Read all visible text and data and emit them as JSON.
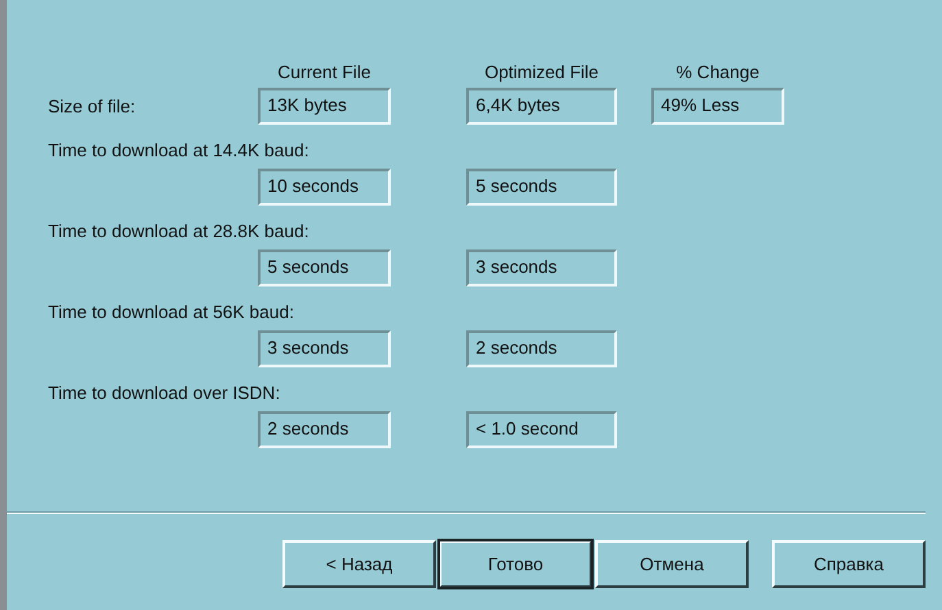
{
  "columns": [
    "Current File",
    "Optimized File",
    "% Change"
  ],
  "rows": [
    {
      "kind": "inline",
      "label": "Size of file:",
      "values": [
        "13K bytes",
        "6,4K bytes",
        "49% Less"
      ]
    },
    {
      "kind": "stacked",
      "label": "Time to download at 14.4K baud:",
      "values": [
        "10 seconds",
        "5 seconds"
      ]
    },
    {
      "kind": "stacked",
      "label": "Time to download at 28.8K baud:",
      "values": [
        "5 seconds",
        "3 seconds"
      ]
    },
    {
      "kind": "stacked",
      "label": "Time to download at 56K baud:",
      "values": [
        "3 seconds",
        "2 seconds"
      ]
    },
    {
      "kind": "stacked",
      "label": "Time to download over ISDN:",
      "values": [
        "2 seconds",
        "< 1.0 second"
      ]
    }
  ],
  "buttons": [
    {
      "label": "< Назад",
      "default": false
    },
    {
      "label": "Готово",
      "default": true
    },
    {
      "label": "Отмена",
      "default": false
    },
    {
      "label": "Справка",
      "default": false
    }
  ]
}
